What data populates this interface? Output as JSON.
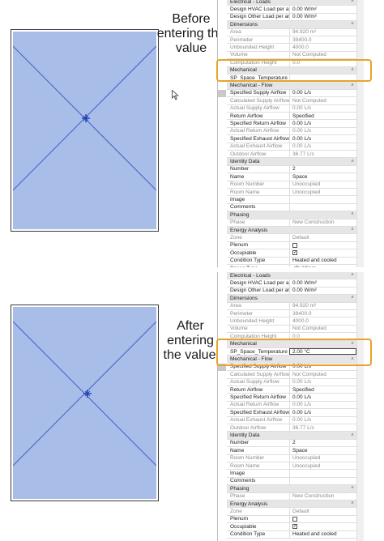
{
  "captions": {
    "before": [
      "Before",
      "entering the",
      "value"
    ],
    "after": [
      "After entering",
      "the value"
    ]
  },
  "colors": {
    "space_fill": "#a9bde9",
    "space_line": "#3f63c8",
    "highlight": "#e8a42a"
  },
  "icons": {
    "cursor": "arrow-cursor-icon",
    "origin": "origin-cross-icon"
  },
  "panel_before": {
    "rows": [
      {
        "kind": "group",
        "name": "Electrical - Loads"
      },
      {
        "kind": "prop",
        "name": "Design HVAC Load per area",
        "value": "0.00 W/m²"
      },
      {
        "kind": "prop",
        "name": "Design Other Load per area",
        "value": "0.00 W/m²"
      },
      {
        "kind": "group",
        "name": "Dimensions"
      },
      {
        "kind": "ro",
        "name": "Area",
        "value": "94.920 m²"
      },
      {
        "kind": "ro",
        "name": "Perimeter",
        "value": "39400.0"
      },
      {
        "kind": "ro",
        "name": "Unbounded Height",
        "value": "4000.0"
      },
      {
        "kind": "ro",
        "name": "Volume",
        "value": "Not Computed"
      },
      {
        "kind": "ro",
        "name": "Computation Height",
        "value": "0.0"
      },
      {
        "kind": "group",
        "name": "Mechanical"
      },
      {
        "kind": "prop",
        "name": "SP_Space_Temperature",
        "value": ""
      },
      {
        "kind": "group",
        "name": "Mechanical - Flow"
      },
      {
        "kind": "prop",
        "name": "Specified Supply Airflow",
        "value": "0.00 L/s"
      },
      {
        "kind": "ro",
        "name": "Calculated Supply Airflow",
        "value": "Not Computed"
      },
      {
        "kind": "ro",
        "name": "Actual Supply Airflow",
        "value": "0.00 L/s"
      },
      {
        "kind": "prop",
        "name": "Return Airflow",
        "value": "Specified"
      },
      {
        "kind": "prop",
        "name": "Specified Return Airflow",
        "value": "0.00 L/s"
      },
      {
        "kind": "ro",
        "name": "Actual Return Airflow",
        "value": "0.00 L/s"
      },
      {
        "kind": "prop",
        "name": "Specified Exhaust Airflow",
        "value": "0.00 L/s"
      },
      {
        "kind": "ro",
        "name": "Actual Exhaust Airflow",
        "value": "0.00 L/s"
      },
      {
        "kind": "ro",
        "name": "Outdoor Airflow",
        "value": "36.77 L/s"
      },
      {
        "kind": "group",
        "name": "Identity Data"
      },
      {
        "kind": "prop",
        "name": "Number",
        "value": "2"
      },
      {
        "kind": "prop",
        "name": "Name",
        "value": "Space"
      },
      {
        "kind": "ro",
        "name": "Room Number",
        "value": "Unoccupied"
      },
      {
        "kind": "ro",
        "name": "Room Name",
        "value": "Unoccupied"
      },
      {
        "kind": "prop",
        "name": "Image",
        "value": ""
      },
      {
        "kind": "prop",
        "name": "Comments",
        "value": ""
      },
      {
        "kind": "group",
        "name": "Phasing"
      },
      {
        "kind": "ro",
        "name": "Phase",
        "value": "New Construction"
      },
      {
        "kind": "group",
        "name": "Energy Analysis"
      },
      {
        "kind": "ro",
        "name": "Zone",
        "value": "Default"
      },
      {
        "kind": "check",
        "name": "Plenum",
        "value": "",
        "checked": false
      },
      {
        "kind": "check",
        "name": "Occupiable",
        "value": "",
        "checked": true
      },
      {
        "kind": "prop",
        "name": "Condition Type",
        "value": "Heated and cooled"
      },
      {
        "kind": "prop",
        "name": "Space Type",
        "value": "<Building>"
      }
    ]
  },
  "panel_after": {
    "rows": [
      {
        "kind": "group",
        "name": "Electrical - Loads"
      },
      {
        "kind": "prop",
        "name": "Design HVAC Load per area",
        "value": "0.00 W/m²"
      },
      {
        "kind": "prop",
        "name": "Design Other Load per area",
        "value": "0.00 W/m²"
      },
      {
        "kind": "group",
        "name": "Dimensions"
      },
      {
        "kind": "ro",
        "name": "Area",
        "value": "94.920 m²"
      },
      {
        "kind": "ro",
        "name": "Perimeter",
        "value": "39400.0"
      },
      {
        "kind": "ro",
        "name": "Unbounded Height",
        "value": "4000.0"
      },
      {
        "kind": "ro",
        "name": "Volume",
        "value": "Not Computed"
      },
      {
        "kind": "ro",
        "name": "Computation Height",
        "value": "0.0"
      },
      {
        "kind": "group",
        "name": "Mechanical"
      },
      {
        "kind": "prop",
        "name": "SP_Space_Temperature",
        "value": "2.00 °C",
        "editing": true
      },
      {
        "kind": "group",
        "name": "Mechanical - Flow"
      },
      {
        "kind": "prop",
        "name": "Specified Supply Airflow",
        "value": "0.00 L/s"
      },
      {
        "kind": "ro",
        "name": "Calculated Supply Airflow",
        "value": "Not Computed"
      },
      {
        "kind": "ro",
        "name": "Actual Supply Airflow",
        "value": "0.00 L/s"
      },
      {
        "kind": "prop",
        "name": "Return Airflow",
        "value": "Specified"
      },
      {
        "kind": "prop",
        "name": "Specified Return Airflow",
        "value": "0.00 L/s"
      },
      {
        "kind": "ro",
        "name": "Actual Return Airflow",
        "value": "0.00 L/s"
      },
      {
        "kind": "prop",
        "name": "Specified Exhaust Airflow",
        "value": "0.00 L/s"
      },
      {
        "kind": "ro",
        "name": "Actual Exhaust Airflow",
        "value": "0.00 L/s"
      },
      {
        "kind": "ro",
        "name": "Outdoor Airflow",
        "value": "36.77 L/s"
      },
      {
        "kind": "group",
        "name": "Identity Data"
      },
      {
        "kind": "prop",
        "name": "Number",
        "value": "2"
      },
      {
        "kind": "prop",
        "name": "Name",
        "value": "Space"
      },
      {
        "kind": "ro",
        "name": "Room Number",
        "value": "Unoccupied"
      },
      {
        "kind": "ro",
        "name": "Room Name",
        "value": "Unoccupied"
      },
      {
        "kind": "prop",
        "name": "Image",
        "value": ""
      },
      {
        "kind": "prop",
        "name": "Comments",
        "value": ""
      },
      {
        "kind": "group",
        "name": "Phasing"
      },
      {
        "kind": "ro",
        "name": "Phase",
        "value": "New Construction"
      },
      {
        "kind": "group",
        "name": "Energy Analysis"
      },
      {
        "kind": "ro",
        "name": "Zone",
        "value": "Default"
      },
      {
        "kind": "check",
        "name": "Plenum",
        "value": "",
        "checked": false
      },
      {
        "kind": "check",
        "name": "Occupiable",
        "value": "",
        "checked": true
      },
      {
        "kind": "prop",
        "name": "Condition Type",
        "value": "Heated and cooled"
      }
    ]
  }
}
